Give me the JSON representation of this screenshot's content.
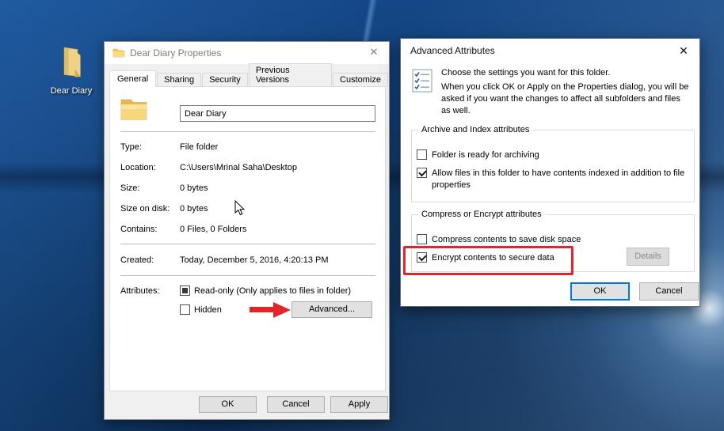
{
  "icons": {
    "close": "✕"
  },
  "desktop": {
    "folder_label": "Dear Diary"
  },
  "properties_dialog": {
    "title": "Dear Diary Properties",
    "tabs": [
      "General",
      "Sharing",
      "Security",
      "Previous Versions",
      "Customize"
    ],
    "selected_tab": "General",
    "name_field_value": "Dear Diary",
    "fields": [
      {
        "label": "Type:",
        "value": "File folder"
      },
      {
        "label": "Location:",
        "value": "C:\\Users\\Mrinal Saha\\Desktop"
      },
      {
        "label": "Size:",
        "value": "0 bytes"
      },
      {
        "label": "Size on disk:",
        "value": "0 bytes"
      },
      {
        "label": "Contains:",
        "value": "0 Files, 0 Folders"
      }
    ],
    "created_row": {
      "label": "Created:",
      "value": "Today, December 5, 2016, 4:20:13 PM"
    },
    "attributes": {
      "label": "Attributes:",
      "readonly": {
        "label": "Read-only (Only applies to files in folder)",
        "state": "indeterminate"
      },
      "hidden": {
        "label": "Hidden",
        "state": "unchecked"
      },
      "advanced_button": "Advanced..."
    },
    "buttons": {
      "ok": "OK",
      "cancel": "Cancel",
      "apply": "Apply"
    }
  },
  "advanced_dialog": {
    "title": "Advanced Attributes",
    "intro_line1": "Choose the settings you want for this folder.",
    "intro_line2": "When you click OK or Apply on the Properties dialog, you will be asked if you want the changes to affect all subfolders and files as well.",
    "groups": [
      {
        "title": "Archive and Index attributes",
        "options": [
          {
            "label": "Folder is ready for archiving",
            "checked": false
          },
          {
            "label": "Allow files in this folder to have contents indexed in addition to file properties",
            "checked": true
          }
        ]
      },
      {
        "title": "Compress or Encrypt attributes",
        "options": [
          {
            "label": "Compress contents to save disk space",
            "checked": false
          },
          {
            "label": "Encrypt contents to secure data",
            "checked": true,
            "highlighted": true
          }
        ]
      }
    ],
    "details_button": "Details",
    "buttons": {
      "ok": "OK",
      "cancel": "Cancel"
    }
  },
  "colors": {
    "highlight_red": "#e3242b",
    "focus_blue": "#0078d7",
    "dialog_bg": "#f0f0f0",
    "desktop_blue": "#123f78"
  }
}
